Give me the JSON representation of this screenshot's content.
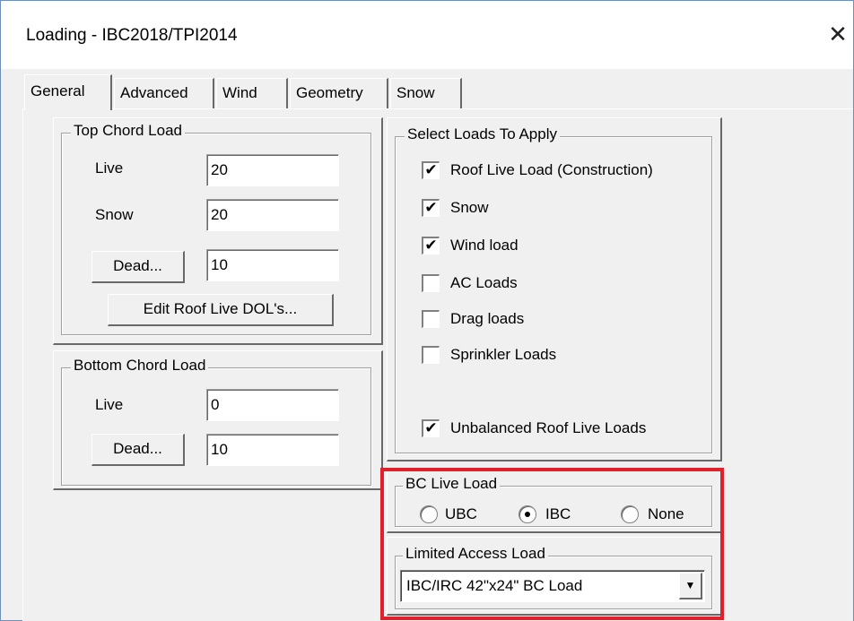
{
  "window": {
    "title": "Loading - IBC2018/TPI2014",
    "close_glyph": "✕"
  },
  "tabs": [
    {
      "label": "General",
      "active": true
    },
    {
      "label": "Advanced",
      "active": false
    },
    {
      "label": "Wind",
      "active": false
    },
    {
      "label": "Geometry",
      "active": false
    },
    {
      "label": "Snow",
      "active": false
    }
  ],
  "top_chord": {
    "title": "Top Chord Load",
    "live_label": "Live",
    "live_value": "20",
    "snow_label": "Snow",
    "snow_value": "20",
    "dead_button": "Dead...",
    "dead_value": "10",
    "edit_dol_button": "Edit Roof Live DOL's..."
  },
  "bottom_chord": {
    "title": "Bottom Chord Load",
    "live_label": "Live",
    "live_value": "0",
    "dead_button": "Dead...",
    "dead_value": "10"
  },
  "select_loads": {
    "title": "Select Loads To Apply",
    "items": [
      {
        "label": "Roof Live Load (Construction)",
        "checked": "✔"
      },
      {
        "label": "Snow",
        "checked": "✔"
      },
      {
        "label": "Wind load",
        "checked": "✔"
      },
      {
        "label": "AC Loads",
        "checked": ""
      },
      {
        "label": "Drag loads",
        "checked": ""
      },
      {
        "label": "Sprinkler Loads",
        "checked": ""
      },
      {
        "label": "Unbalanced Roof Live Loads",
        "checked": "✔"
      }
    ]
  },
  "bc_live_load": {
    "title": "BC Live Load",
    "options": [
      {
        "label": "UBC",
        "selected": false
      },
      {
        "label": "IBC",
        "selected": true
      },
      {
        "label": "None",
        "selected": false
      }
    ]
  },
  "limited_access": {
    "title": "Limited Access Load",
    "selected": "IBC/IRC 42\"x24\" BC Load",
    "arrow_glyph": "▼"
  },
  "colors": {
    "highlight": "#e0202a",
    "window_border": "#6f8fb8",
    "face": "#f0f0f0"
  }
}
